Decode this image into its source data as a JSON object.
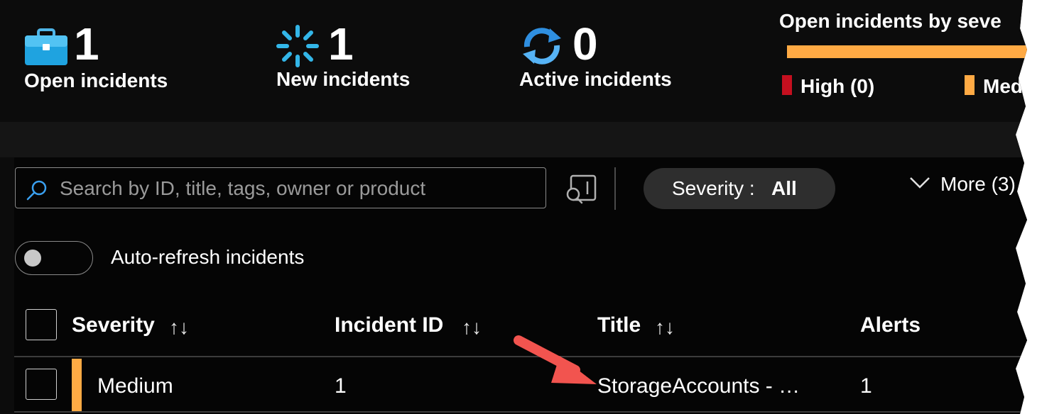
{
  "summary": {
    "open": {
      "count": "1",
      "label": "Open incidents",
      "icon": "briefcase-icon"
    },
    "new": {
      "count": "1",
      "label": "New incidents",
      "icon": "spinner-icon"
    },
    "active": {
      "count": "0",
      "label": "Active incidents",
      "icon": "refresh-icon"
    }
  },
  "severity_chart": {
    "title": "Open incidents by seve",
    "legend": [
      {
        "label": "High (0)",
        "color": "#c50f1f"
      },
      {
        "label": "Med",
        "color": "#ffaa44"
      }
    ],
    "bar_color": "#ffaa44"
  },
  "toolbar": {
    "search_placeholder": "Search by ID, title, tags, owner or product",
    "severity_filter_label": "Severity : ",
    "severity_filter_value": "All",
    "more_label": "More (3)"
  },
  "auto_refresh": {
    "label": "Auto-refresh incidents",
    "enabled": false
  },
  "table": {
    "columns": [
      "Severity",
      "Incident ID",
      "Title",
      "Alerts"
    ],
    "rows": [
      {
        "severity": "Medium",
        "severity_color": "#ffaa44",
        "incident_id": "1",
        "title": "StorageAccounts - …",
        "alerts": "1"
      }
    ]
  },
  "annotation": {
    "arrow_color": "#f2544f"
  }
}
